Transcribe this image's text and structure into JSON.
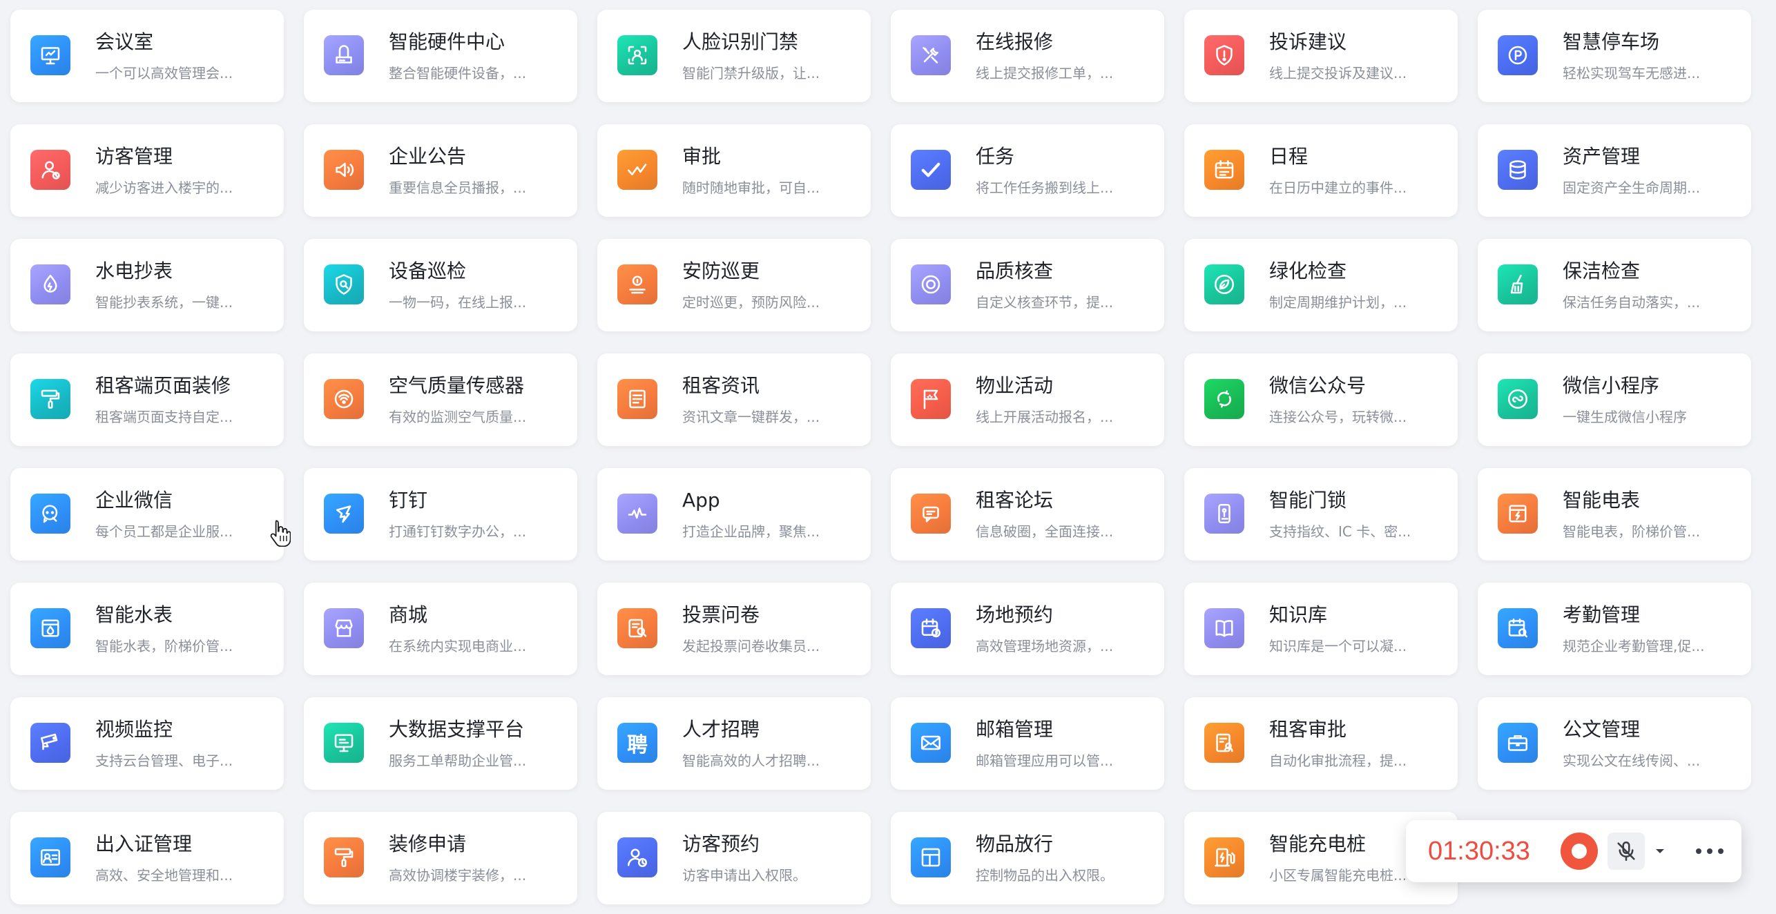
{
  "apps": [
    {
      "title": "会议室",
      "desc": "一个可以高效管理会...",
      "icon": "presentation-board-icon",
      "color": "#2e8ef7"
    },
    {
      "title": "智能硬件中心",
      "desc": "整合智能硬件设备，...",
      "icon": "hardware-device-icon",
      "color": "#8b8df2"
    },
    {
      "title": "人脸识别门禁",
      "desc": "智能门禁升级版，让...",
      "icon": "face-scan-icon",
      "color": "#19c39a"
    },
    {
      "title": "在线报修",
      "desc": "线上提交报修工单，...",
      "icon": "repair-tools-icon",
      "color": "#8f8cf0"
    },
    {
      "title": "投诉建议",
      "desc": "线上提交投诉及建议...",
      "icon": "shield-alert-icon",
      "color": "#f35a5a"
    },
    {
      "title": "智慧停车场",
      "desc": "轻松实现驾车无感进...",
      "icon": "parking-icon",
      "color": "#4a6cf1"
    },
    {
      "title": "访客管理",
      "desc": "减少访客进入楼宇的...",
      "icon": "visitor-icon",
      "color": "#f35a5a"
    },
    {
      "title": "企业公告",
      "desc": "重要信息全员播报，...",
      "icon": "speaker-icon",
      "color": "#f57a3d"
    },
    {
      "title": "审批",
      "desc": "随时随地审批，可自...",
      "icon": "approval-check-icon",
      "color": "#f5862b"
    },
    {
      "title": "任务",
      "desc": "将工作任务搬到线上...",
      "icon": "checkmark-icon",
      "color": "#4e6cf0"
    },
    {
      "title": "日程",
      "desc": "在日历中建立的事件...",
      "icon": "calendar-icon",
      "color": "#f7872a"
    },
    {
      "title": "资产管理",
      "desc": "固定资产全生命周期...",
      "icon": "database-icon",
      "color": "#4e6cf0"
    },
    {
      "title": "水电抄表",
      "desc": "智能抄表系统，一键...",
      "icon": "water-drop-icon",
      "color": "#8f8cf0"
    },
    {
      "title": "设备巡检",
      "desc": "一物一码，在线上报...",
      "icon": "shield-search-icon",
      "color": "#17b8c4"
    },
    {
      "title": "安防巡更",
      "desc": "定时巡更，预防风险...",
      "icon": "guard-patrol-icon",
      "color": "#f57a3d"
    },
    {
      "title": "品质核查",
      "desc": "自定义核查环节，提...",
      "icon": "quality-ring-icon",
      "color": "#8f8cf0"
    },
    {
      "title": "绿化检查",
      "desc": "制定周期维护计划，...",
      "icon": "leaf-icon",
      "color": "#19c39a"
    },
    {
      "title": "保洁检查",
      "desc": "保洁任务自动落实，...",
      "icon": "broom-icon",
      "color": "#19c39a"
    },
    {
      "title": "租客端页面装修",
      "desc": "租客端页面支持自定...",
      "icon": "paint-roller-icon",
      "color": "#17b8c4"
    },
    {
      "title": "空气质量传感器",
      "desc": "有效的监测空气质量...",
      "icon": "air-sensor-icon",
      "color": "#f57a3d"
    },
    {
      "title": "租客资讯",
      "desc": "资讯文章一键群发，...",
      "icon": "news-icon",
      "color": "#f57a3d"
    },
    {
      "title": "物业活动",
      "desc": "线上开展活动报名，...",
      "icon": "flag-icon",
      "color": "#f55c4a"
    },
    {
      "title": "微信公众号",
      "desc": "连接公众号，玩转微...",
      "icon": "wechat-official-icon",
      "color": "#19b955"
    },
    {
      "title": "微信小程序",
      "desc": "一键生成微信小程序",
      "icon": "mini-program-icon",
      "color": "#19c39a"
    },
    {
      "title": "企业微信",
      "desc": "每个员工都是企业服...",
      "icon": "wecom-icon",
      "color": "#2e8ef7"
    },
    {
      "title": "钉钉",
      "desc": "打通钉钉数字办公，...",
      "icon": "dingtalk-icon",
      "color": "#2e8ef7"
    },
    {
      "title": "App",
      "desc": "打造企业品牌，聚焦...",
      "icon": "app-wave-icon",
      "color": "#8f8cf0"
    },
    {
      "title": "租客论坛",
      "desc": "信息破圈，全面连接...",
      "icon": "forum-chat-icon",
      "color": "#f57a3d"
    },
    {
      "title": "智能门锁",
      "desc": "支持指纹、IC 卡、密...",
      "icon": "door-lock-icon",
      "color": "#8f8cf0"
    },
    {
      "title": "智能电表",
      "desc": "智能电表，阶梯价管...",
      "icon": "electric-meter-icon",
      "color": "#f57a3d"
    },
    {
      "title": "智能水表",
      "desc": "智能水表，阶梯价管...",
      "icon": "water-meter-icon",
      "color": "#2e8ef7"
    },
    {
      "title": "商城",
      "desc": "在系统内实现电商业...",
      "icon": "shop-icon",
      "color": "#8f8cf0"
    },
    {
      "title": "投票问卷",
      "desc": "发起投票问卷收集员...",
      "icon": "survey-icon",
      "color": "#f57a3d"
    },
    {
      "title": "场地预约",
      "desc": "高效管理场地资源，...",
      "icon": "calendar-clock-icon",
      "color": "#4e6cf0"
    },
    {
      "title": "知识库",
      "desc": "知识库是一个可以凝...",
      "icon": "book-icon",
      "color": "#8f8cf0"
    },
    {
      "title": "考勤管理",
      "desc": "规范企业考勤管理,促...",
      "icon": "attendance-icon",
      "color": "#2e8ef7"
    },
    {
      "title": "视频监控",
      "desc": "支持云台管理、电子...",
      "icon": "cctv-camera-icon",
      "color": "#4e6cf0"
    },
    {
      "title": "大数据支撑平台",
      "desc": "服务工单帮助企业管...",
      "icon": "monitor-icon",
      "color": "#19c39a"
    },
    {
      "title": "人才招聘",
      "desc": "智能高效的人才招聘...",
      "icon": "recruit-icon",
      "color": "#2e8ef7",
      "glyph": "聘"
    },
    {
      "title": "邮箱管理",
      "desc": "邮箱管理应用可以管...",
      "icon": "mail-icon",
      "color": "#2e8ef7"
    },
    {
      "title": "租客审批",
      "desc": "自动化审批流程，提...",
      "icon": "tenant-approval-icon",
      "color": "#f5862b"
    },
    {
      "title": "公文管理",
      "desc": "实现公文在线传阅、...",
      "icon": "briefcase-icon",
      "color": "#2e8ef7"
    },
    {
      "title": "出入证管理",
      "desc": "高效、安全地管理和...",
      "icon": "id-card-icon",
      "color": "#2e8ef7"
    },
    {
      "title": "装修申请",
      "desc": "高效协调楼宇装修，...",
      "icon": "paint-roller-icon",
      "color": "#f57a3d"
    },
    {
      "title": "访客预约",
      "desc": "访客申请出入权限。",
      "icon": "visitor-clock-icon",
      "color": "#4e6cf0"
    },
    {
      "title": "物品放行",
      "desc": "控制物品的出入权限。",
      "icon": "layout-panel-icon",
      "color": "#2e8ef7"
    },
    {
      "title": "智能充电桩",
      "desc": "小区专属智能充电桩...",
      "icon": "charging-pile-icon",
      "color": "#f5862b"
    }
  ],
  "recorder": {
    "time": "01:30:33",
    "record_icon": "record-icon",
    "mic_icon": "mic-muted-icon",
    "dropdown_icon": "chevron-down-icon",
    "more_icon": "more-dots-icon",
    "accent": "#ef4b3f"
  },
  "cursor": {
    "icon": "hand-pointer-icon"
  }
}
